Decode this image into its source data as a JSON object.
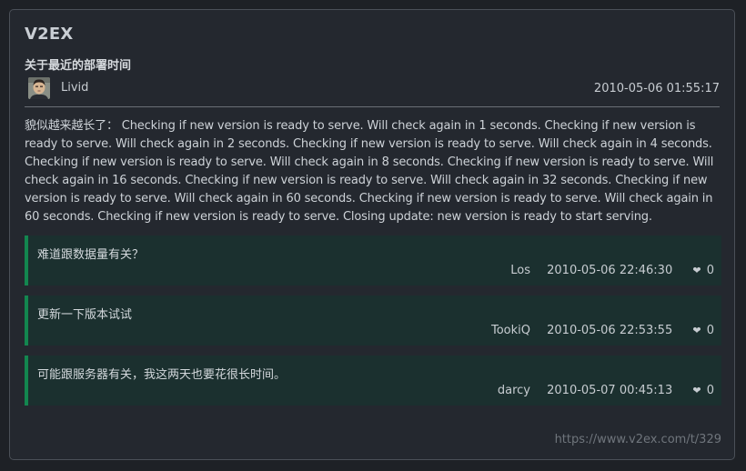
{
  "site": {
    "name": "V2EX"
  },
  "topic": {
    "title": "关于最近的部署时间",
    "author": "Livid",
    "time": "2010-05-06 01:55:17",
    "content": "貌似越来越长了： Checking if new version is ready to serve. Will check again in 1 seconds. Checking if new version is ready to serve. Will check again in 2 seconds. Checking if new version is ready to serve. Will check again in 4 seconds. Checking if new version is ready to serve. Will check again in 8 seconds. Checking if new version is ready to serve. Will check again in 16 seconds. Checking if new version is ready to serve. Will check again in 32 seconds. Checking if new version is ready to serve. Will check again in 60 seconds. Checking if new version is ready to serve. Will check again in 60 seconds. Checking if new version is ready to serve. Closing update: new version is ready to start serving."
  },
  "replies": [
    {
      "text": "难道跟数据量有关？",
      "user": "Los",
      "time": "2010-05-06 22:46:30",
      "likes": "0"
    },
    {
      "text": "更新一下版本试试",
      "user": "TookiQ",
      "time": "2010-05-06 22:53:55",
      "likes": "0"
    },
    {
      "text": "可能跟服务器有关，我这两天也要花很长时间。",
      "user": "darcy",
      "time": "2010-05-07 00:45:13",
      "likes": "0"
    }
  ],
  "footer": {
    "url": "https://www.v2ex.com/t/329"
  },
  "colors": {
    "accent": "#13864f",
    "reply_bg": "#1b302f",
    "card_bg": "#24282f"
  },
  "icons": {
    "like": "heart-icon",
    "avatar": "avatar-image"
  }
}
